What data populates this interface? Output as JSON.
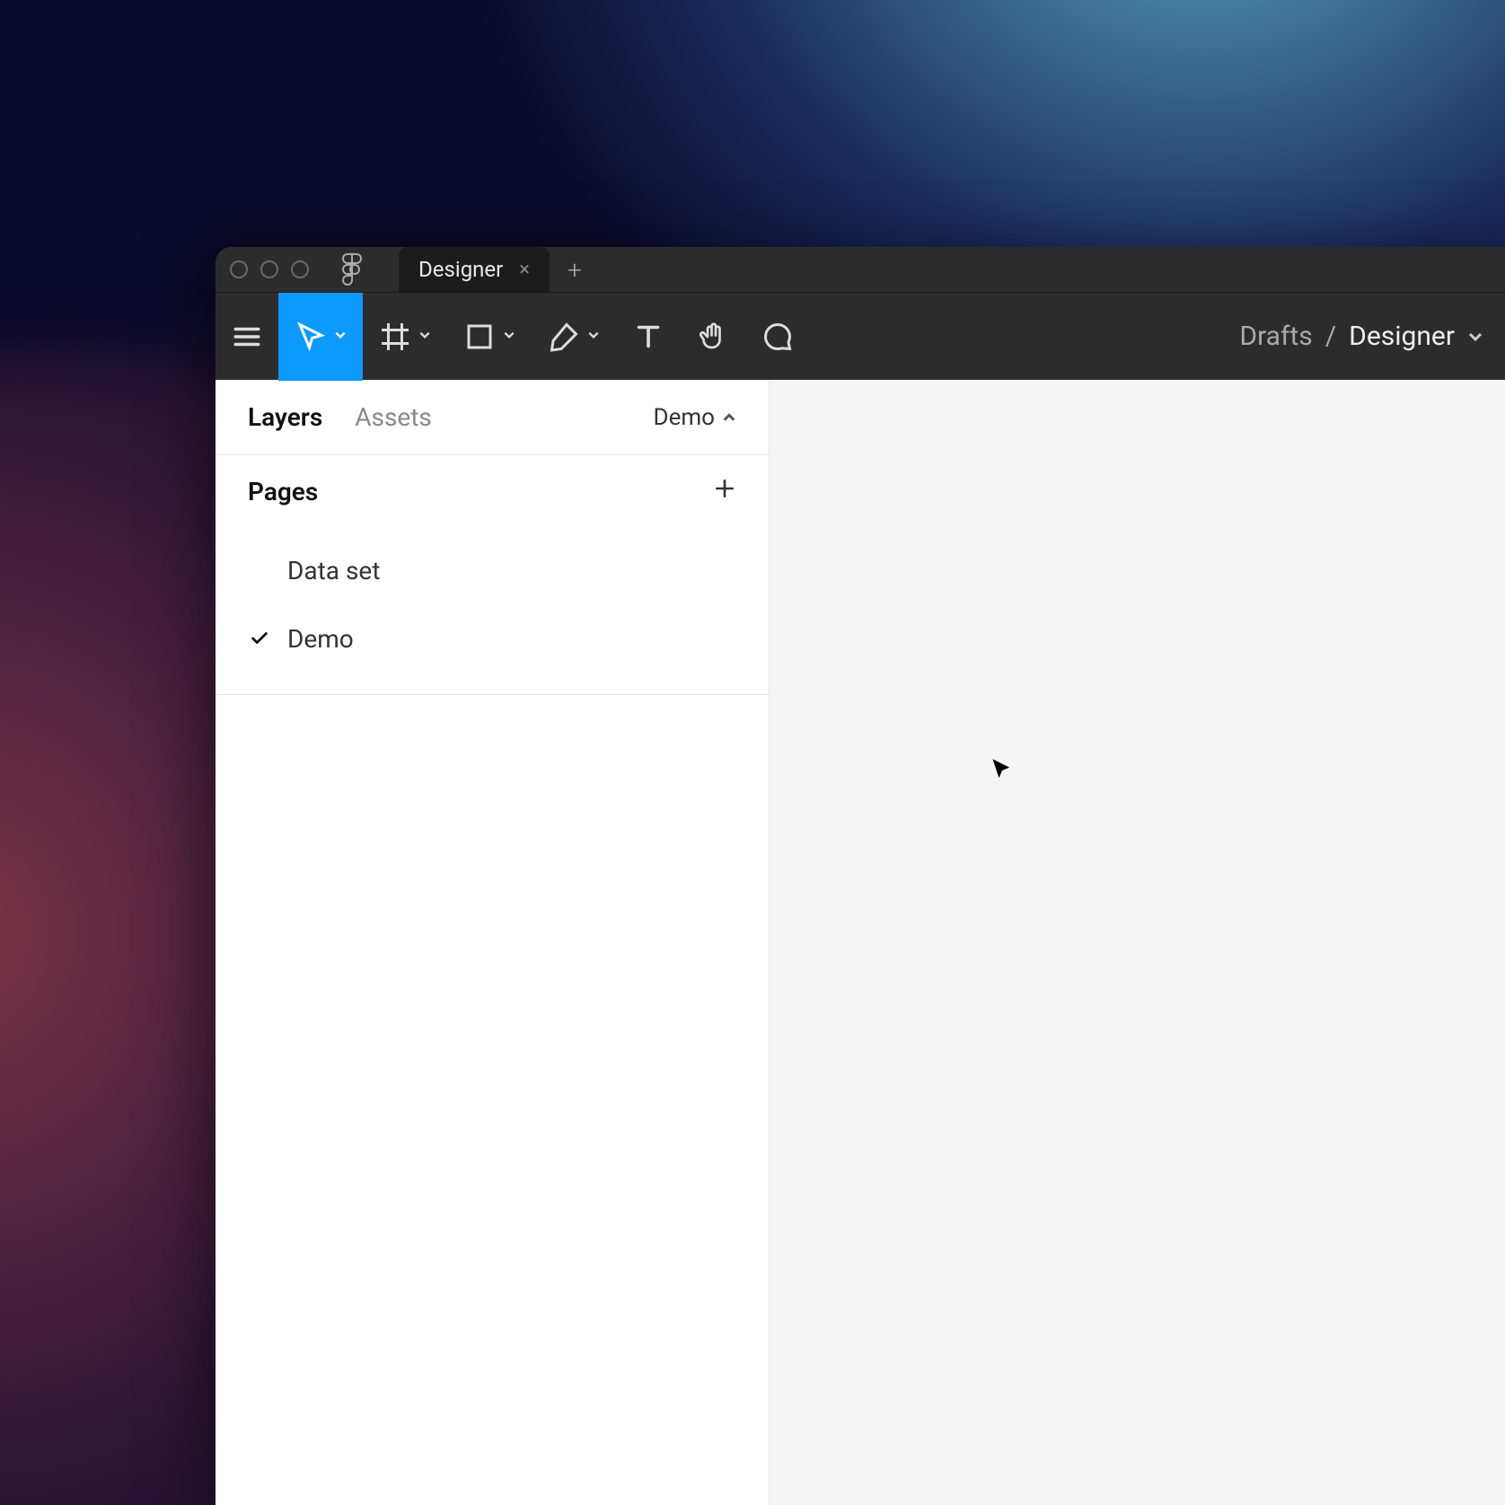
{
  "titlebar": {
    "tab_label": "Designer"
  },
  "toolbar": {
    "tools": {
      "menu": "menu",
      "move": "move",
      "frame": "frame",
      "shape": "rectangle",
      "pen": "pen",
      "text": "text",
      "hand": "hand",
      "comment": "comment"
    }
  },
  "breadcrumb": {
    "parent": "Drafts",
    "separator": "/",
    "current": "Designer"
  },
  "sidebar": {
    "tabs": {
      "layers": "Layers",
      "assets": "Assets"
    },
    "page_selector": "Demo",
    "pages_header": "Pages",
    "pages": [
      {
        "name": "Data set",
        "active": false
      },
      {
        "name": "Demo",
        "active": true
      }
    ]
  }
}
